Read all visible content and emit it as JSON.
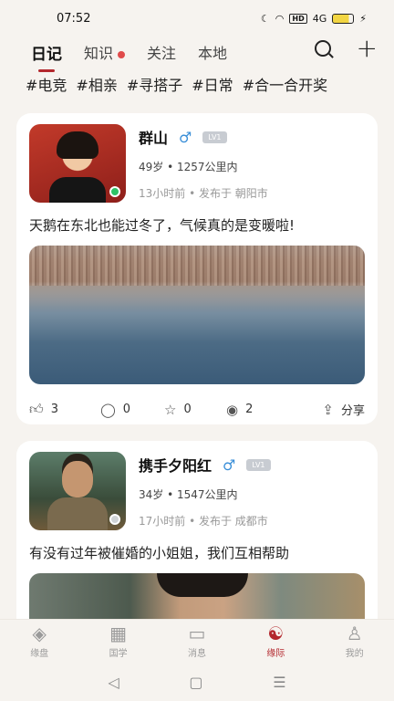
{
  "status_bar": {
    "time": "07:52",
    "hd": "HD",
    "signal": "4G"
  },
  "tabs": [
    {
      "label": "日记",
      "active": true
    },
    {
      "label": "知识",
      "active": false,
      "dot": true
    },
    {
      "label": "关注",
      "active": false
    },
    {
      "label": "本地",
      "active": false
    }
  ],
  "hashtags": [
    "#电竞",
    "#相亲",
    "#寻搭子",
    "#日常",
    "#合一合开奖"
  ],
  "posts": [
    {
      "name": "群山",
      "gender": "♂",
      "level": "LV1",
      "meta": "49岁 • 1257公里内",
      "time_loc": "13小时前 •  发布于  朝阳市",
      "text": "天鹅在东北也能过冬了，气候真的是变暖啦!",
      "likes": "3",
      "comments": "0",
      "favorites": "0",
      "views": "2",
      "share": "分享"
    },
    {
      "name": "携手夕阳红",
      "gender": "♂",
      "level": "LV1",
      "meta": "34岁 • 1547公里内",
      "time_loc": "17小时前 •  发布于  成都市",
      "text": "有没有过年被催婚的小姐姐，我们互相帮助"
    }
  ],
  "bottom_nav": [
    {
      "label": "缘盘",
      "icon": "◈",
      "active": false
    },
    {
      "label": "国学",
      "icon": "▦",
      "active": false
    },
    {
      "label": "消息",
      "icon": "▭",
      "active": false
    },
    {
      "label": "缘际",
      "icon": "☯",
      "active": true
    },
    {
      "label": "我的",
      "icon": "♙",
      "active": false
    }
  ],
  "colors": {
    "accent": "#b3272d",
    "background": "#f6f3ef"
  }
}
